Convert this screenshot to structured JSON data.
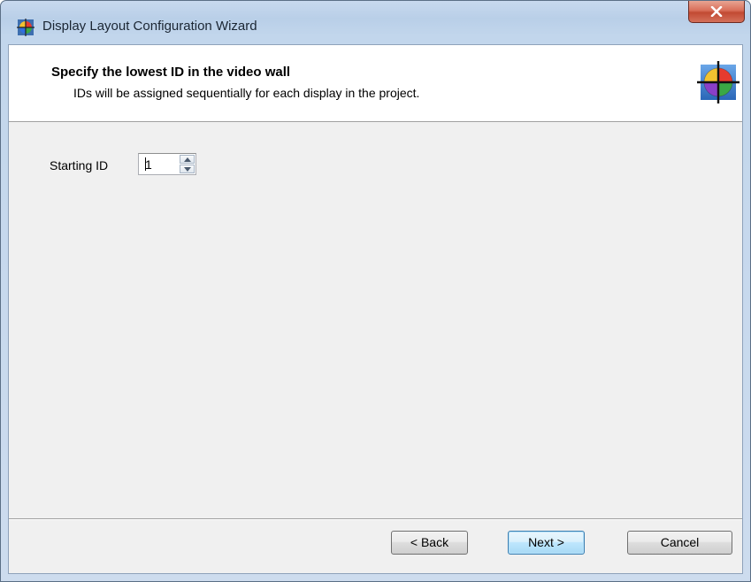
{
  "window": {
    "title": "Display Layout Configuration Wizard",
    "close_label": "x"
  },
  "header": {
    "title": "Specify the lowest ID in the video wall",
    "subtitle": "IDs will be assigned sequentially for each display in the project."
  },
  "form": {
    "starting_id_label": "Starting ID",
    "starting_id_value": "1"
  },
  "buttons": {
    "back": "< Back",
    "next": "Next >",
    "cancel": "Cancel"
  },
  "icons": {
    "app": "color-wheel-icon",
    "header": "color-wheel-crosshair-icon",
    "close": "close-icon",
    "spin_up": "spin-up-icon",
    "spin_down": "spin-down-icon"
  },
  "colors": {
    "titlebar": "#c2d6ec",
    "close_button": "#c24a33",
    "header_background": "#ffffff",
    "dialog_background": "#f0f0f0",
    "default_button_border": "#3c7fb1"
  }
}
